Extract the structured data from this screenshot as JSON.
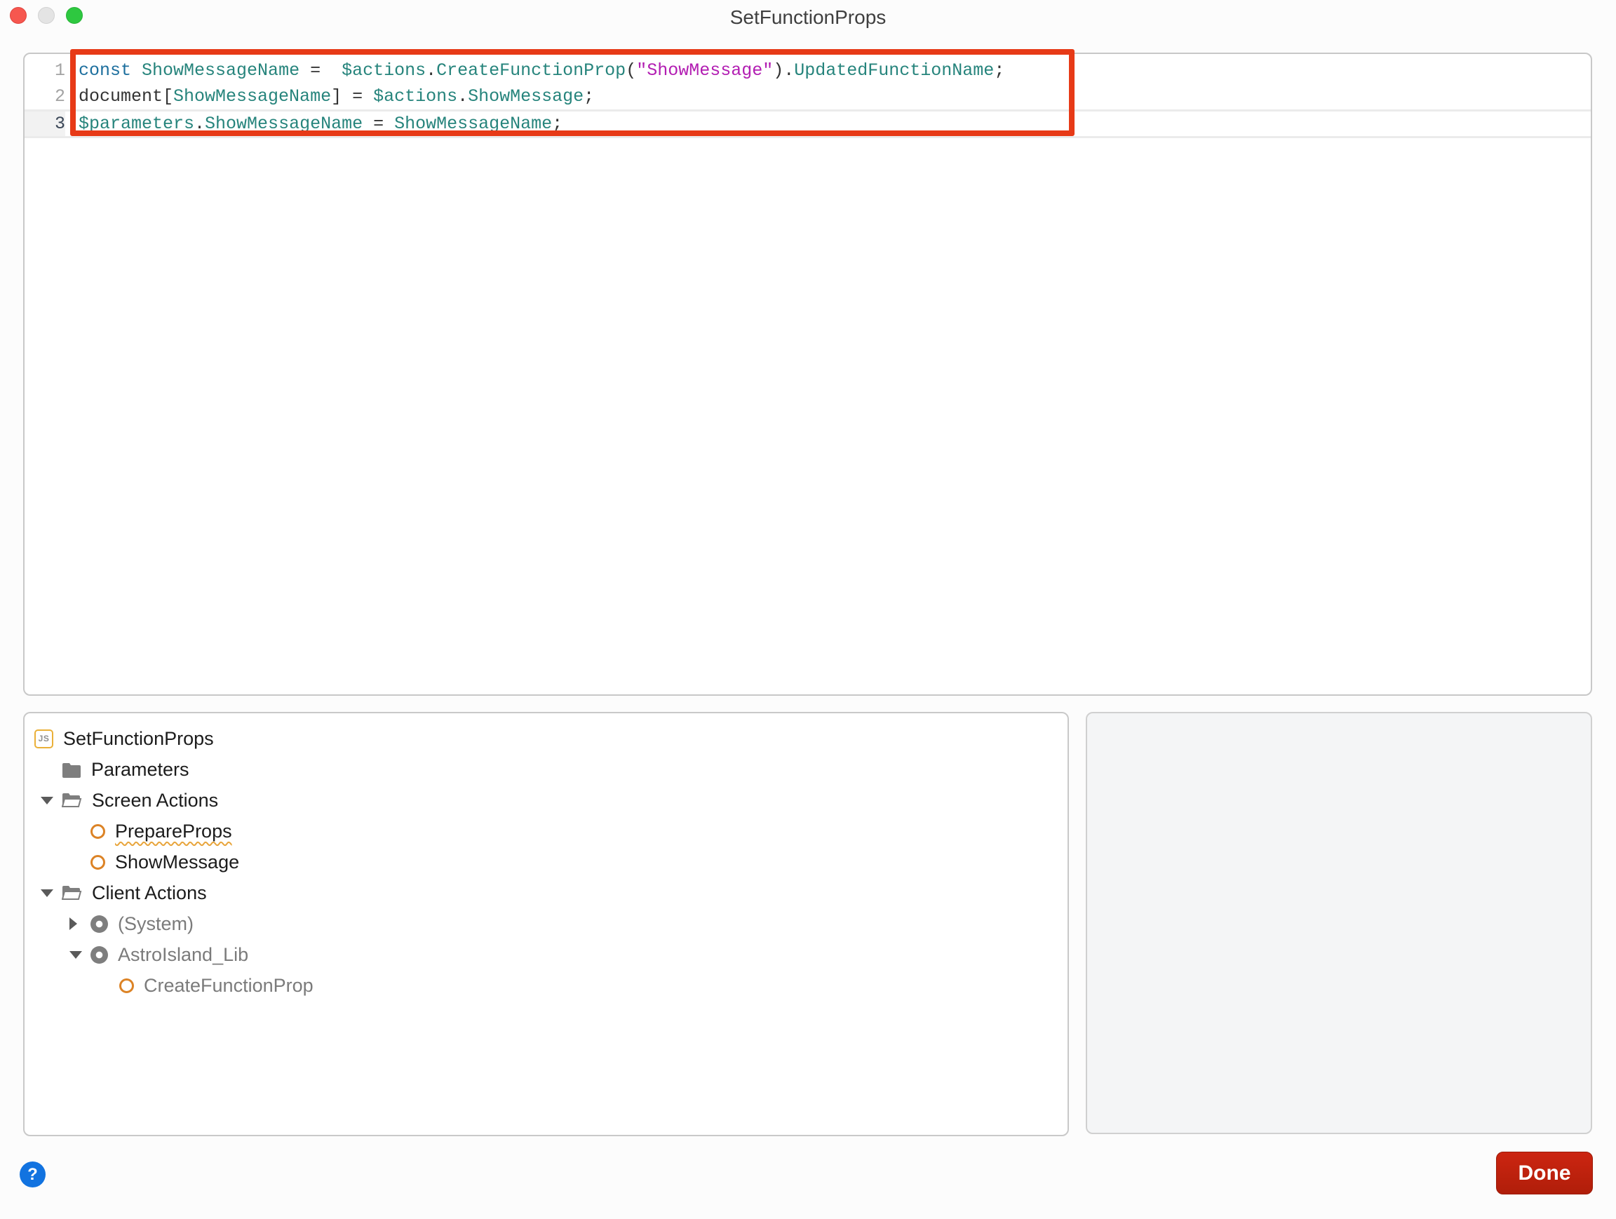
{
  "window": {
    "title": "SetFunctionProps",
    "traffic_lights": [
      "close",
      "minimize",
      "zoom"
    ]
  },
  "colors": {
    "annotation_red": "#e73a17",
    "done_button_red": "#c22310",
    "help_blue": "#1273e0",
    "syntax_keyword": "#1d6f9e",
    "syntax_identifier": "#26847c",
    "syntax_string": "#b21db2",
    "syntax_plain": "#333333",
    "action_circle_orange": "#dc8326",
    "js_badge_amber": "#eab038",
    "folder_gray": "#7e7e7e"
  },
  "editor": {
    "lines": [
      {
        "number": "1",
        "active": false,
        "tokens": [
          {
            "text": "const",
            "type": "kw"
          },
          {
            "text": " ",
            "type": "pl"
          },
          {
            "text": "ShowMessageName",
            "type": "id"
          },
          {
            "text": " =  ",
            "type": "pl"
          },
          {
            "text": "$actions",
            "type": "id"
          },
          {
            "text": ".",
            "type": "pl"
          },
          {
            "text": "CreateFunctionProp",
            "type": "id"
          },
          {
            "text": "(",
            "type": "pl"
          },
          {
            "text": "\"ShowMessage\"",
            "type": "str"
          },
          {
            "text": ").",
            "type": "pl"
          },
          {
            "text": "UpdatedFunctionName",
            "type": "id"
          },
          {
            "text": ";",
            "type": "pl"
          }
        ]
      },
      {
        "number": "2",
        "active": false,
        "tokens": [
          {
            "text": "document[",
            "type": "pl"
          },
          {
            "text": "ShowMessageName",
            "type": "id"
          },
          {
            "text": "] = ",
            "type": "pl"
          },
          {
            "text": "$actions",
            "type": "id"
          },
          {
            "text": ".",
            "type": "pl"
          },
          {
            "text": "ShowMessage",
            "type": "id"
          },
          {
            "text": ";",
            "type": "pl"
          }
        ]
      },
      {
        "number": "3",
        "active": true,
        "tokens": [
          {
            "text": "$parameters",
            "type": "id"
          },
          {
            "text": ".",
            "type": "pl"
          },
          {
            "text": "ShowMessageName",
            "type": "id"
          },
          {
            "text": " = ",
            "type": "pl"
          },
          {
            "text": "ShowMessageName",
            "type": "id"
          },
          {
            "text": ";",
            "type": "pl"
          }
        ]
      }
    ]
  },
  "tree": {
    "rows": [
      {
        "label": "SetFunctionProps",
        "icon": "js",
        "level": 0,
        "expander": "none",
        "muted": false,
        "wavy": false
      },
      {
        "label": "Parameters",
        "icon": "folder",
        "level": 1,
        "expander": "slot",
        "muted": false,
        "wavy": false
      },
      {
        "label": "Screen Actions",
        "icon": "folder-open",
        "level": 1,
        "expander": "down",
        "muted": false,
        "wavy": false
      },
      {
        "label": "PrepareProps",
        "icon": "circle",
        "level": 2,
        "expander": "slot",
        "muted": false,
        "wavy": true
      },
      {
        "label": "ShowMessage",
        "icon": "circle",
        "level": 2,
        "expander": "slot",
        "muted": false,
        "wavy": false
      },
      {
        "label": "Client Actions",
        "icon": "folder-open",
        "level": 1,
        "expander": "down",
        "muted": false,
        "wavy": false
      },
      {
        "label": "(System)",
        "icon": "donut",
        "level": 2,
        "expander": "right",
        "muted": true,
        "wavy": false
      },
      {
        "label": "AstroIsland_Lib",
        "icon": "donut",
        "level": 2,
        "expander": "down",
        "muted": true,
        "wavy": false
      },
      {
        "label": "CreateFunctionProp",
        "icon": "circle",
        "level": 3,
        "expander": "slot",
        "muted": true,
        "wavy": false
      }
    ],
    "js_badge_text": "JS"
  },
  "footer": {
    "help_label": "?",
    "done_label": "Done"
  }
}
